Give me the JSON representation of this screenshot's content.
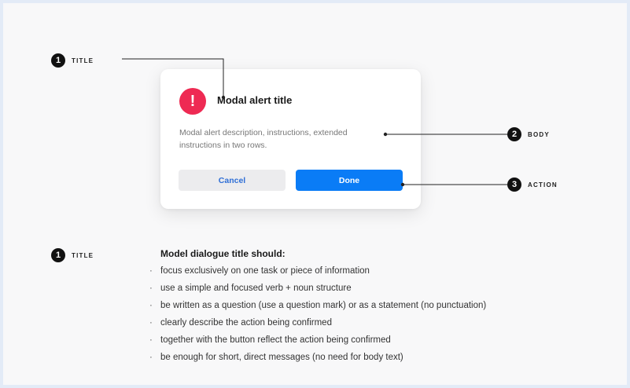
{
  "callouts": [
    {
      "number": "1",
      "label": "TITLE"
    },
    {
      "number": "2",
      "label": "BODY"
    },
    {
      "number": "3",
      "label": "ACTION"
    }
  ],
  "modal": {
    "icon": "exclamation-icon",
    "icon_glyph": "!",
    "title": "Modal alert title",
    "description": "Modal alert description, instructions, extended instructions in two rows.",
    "cancel_label": "Cancel",
    "done_label": "Done"
  },
  "guidelines": {
    "number": "1",
    "label": "TITLE",
    "heading": "Model dialogue title should:",
    "items": [
      "focus exclusively on one task or piece of information",
      "use a simple and focused verb + noun structure",
      "be written as a question (use a question mark) or as a statement (no punctuation)",
      "clearly describe the action being confirmed",
      "together with the button reflect the action being confirmed",
      "be enough for short, direct messages (no need for body text)"
    ]
  },
  "colors": {
    "alert": "#ee2a53",
    "primary": "#0a7cf6",
    "page_background": "#e3ebf7"
  }
}
